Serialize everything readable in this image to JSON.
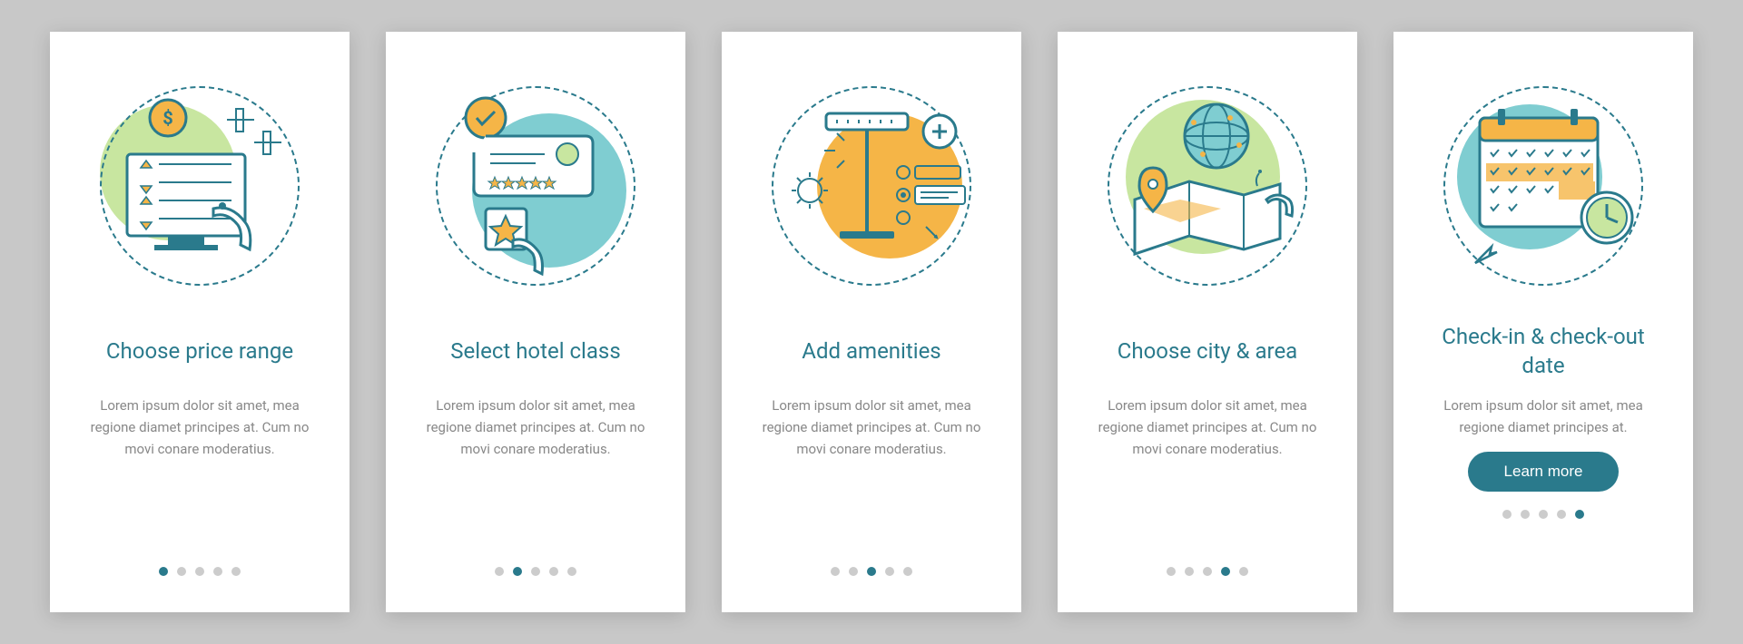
{
  "cards": [
    {
      "title": "Choose price range",
      "desc": "Lorem ipsum dolor sit amet, mea regione diamet principes at. Cum no movi conare moderatius."
    },
    {
      "title": "Select hotel class",
      "desc": "Lorem ipsum dolor sit amet, mea regione diamet principes at. Cum no movi conare moderatius."
    },
    {
      "title": "Add amenities",
      "desc": "Lorem ipsum dolor sit amet, mea regione diamet principes at. Cum no movi conare moderatius."
    },
    {
      "title": "Choose city & area",
      "desc": "Lorem ipsum dolor sit amet, mea regione diamet principes at. Cum no movi conare moderatius."
    },
    {
      "title": "Check-in & check-out date",
      "desc": "Lorem ipsum dolor sit amet, mea regione diamet principes at."
    }
  ],
  "cta": "Learn more"
}
